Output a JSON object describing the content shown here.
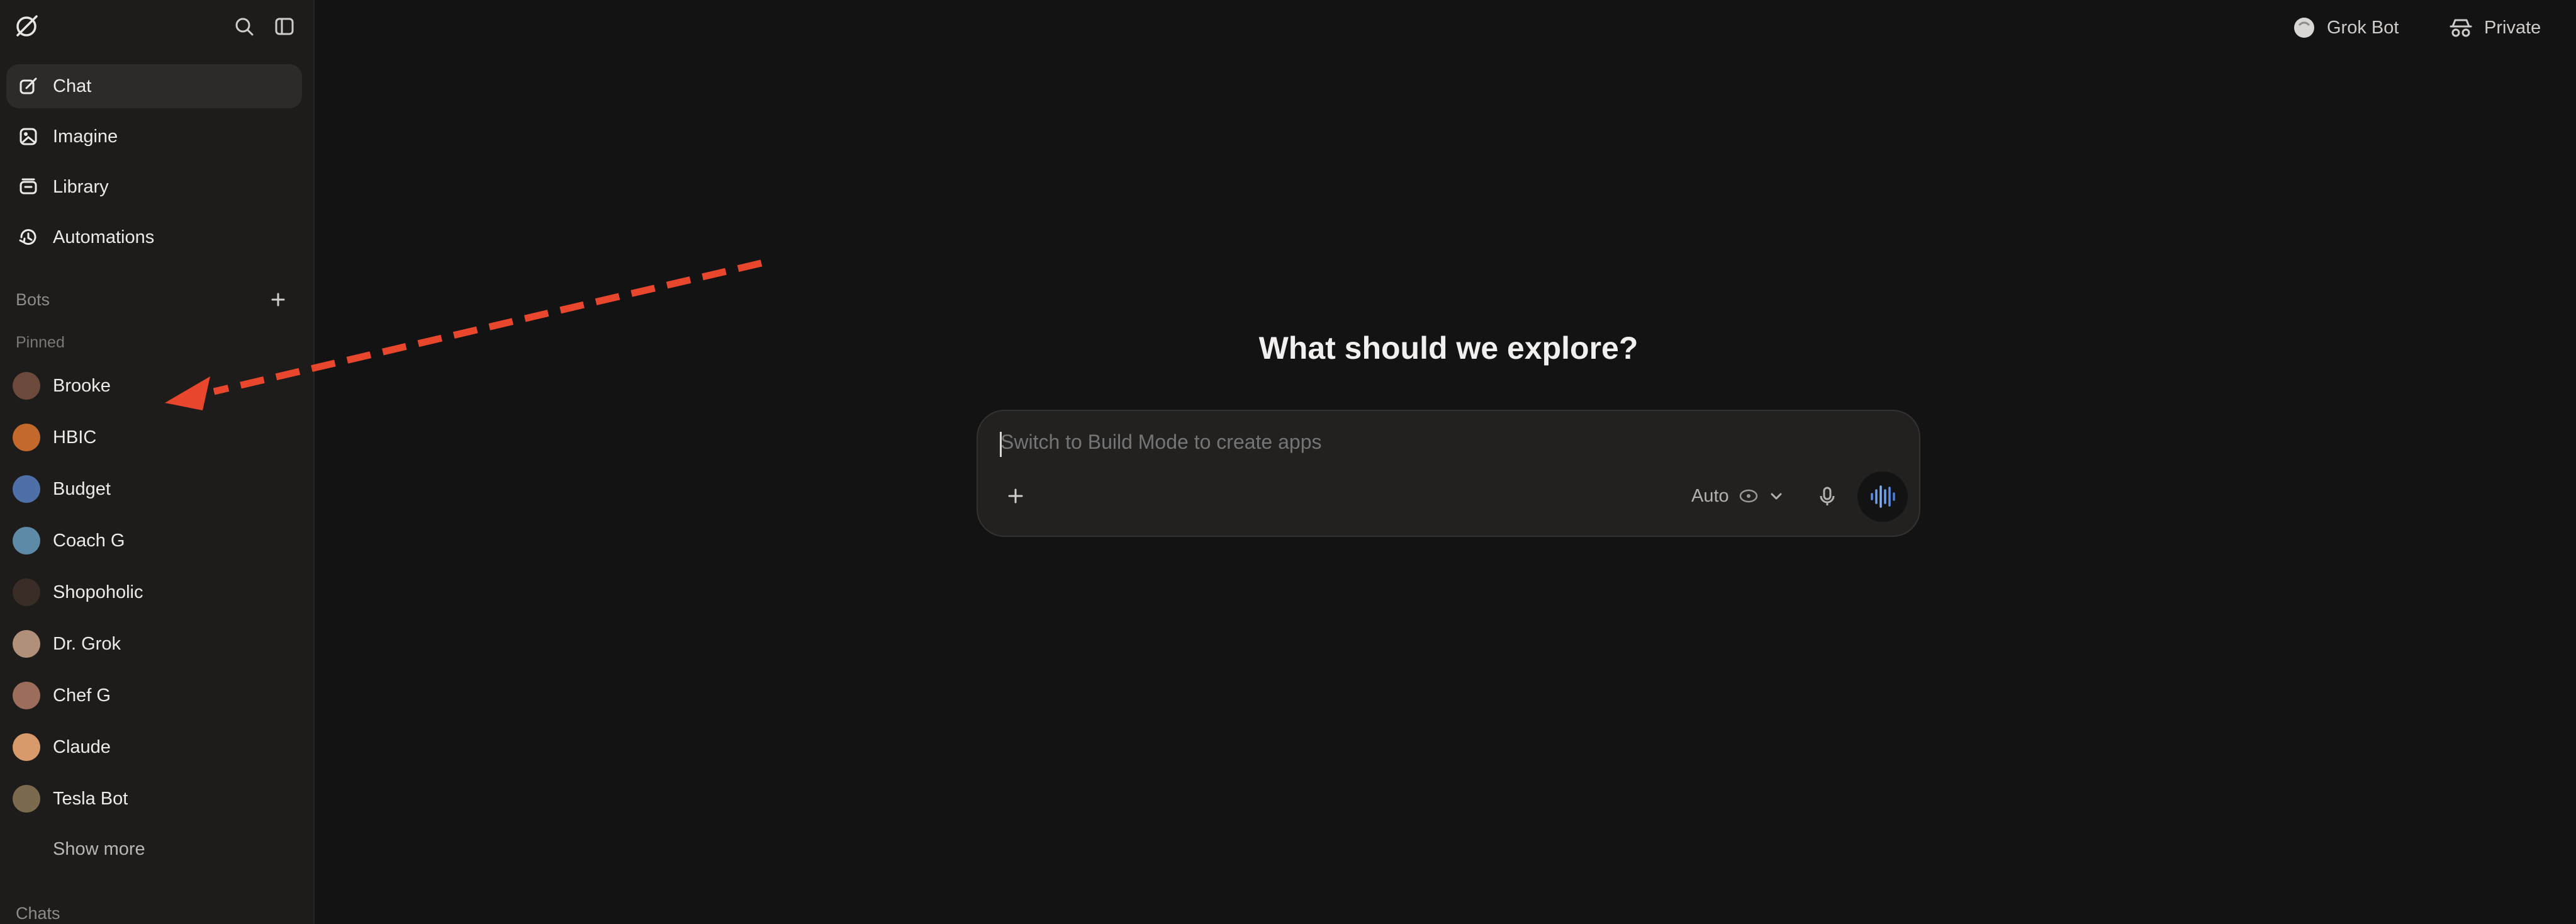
{
  "sidebar": {
    "nav": [
      {
        "label": "Chat",
        "icon": "edit-icon"
      },
      {
        "label": "Imagine",
        "icon": "image-icon"
      },
      {
        "label": "Library",
        "icon": "library-icon"
      },
      {
        "label": "Automations",
        "icon": "automations-icon"
      }
    ],
    "bots_label": "Bots",
    "pinned_label": "Pinned",
    "bots": [
      {
        "label": "Brooke",
        "color": "#6b4a3c"
      },
      {
        "label": "HBIC",
        "color": "#c2692b"
      },
      {
        "label": "Budget",
        "color": "#4f6fa8"
      },
      {
        "label": "Coach G",
        "color": "#5d8aa6"
      },
      {
        "label": "Shopoholic",
        "color": "#3a2c26"
      },
      {
        "label": "Dr. Grok",
        "color": "#b09078"
      },
      {
        "label": "Chef G",
        "color": "#9b6d5a"
      },
      {
        "label": "Claude",
        "color": "#d89a6a"
      },
      {
        "label": "Tesla Bot",
        "color": "#7c6a4e"
      }
    ],
    "show_more": "Show more",
    "chats_label": "Chats"
  },
  "header": {
    "grok_bot": "Grok Bot",
    "private": "Private"
  },
  "main": {
    "heading": "What should we explore?",
    "input_placeholder": "Switch to Build Mode to create apps",
    "mode_label": "Auto"
  },
  "colors": {
    "background": "#141313",
    "sidebar": "#1d1c1b",
    "annotation_arrow": "#e8472e",
    "voice_accent": "#5b8fe8"
  }
}
